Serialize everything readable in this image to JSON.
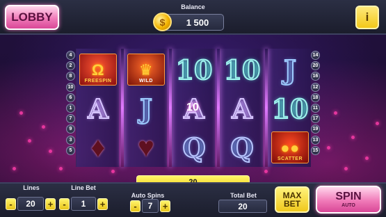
{
  "header": {
    "lobby_label": "LOBBY",
    "balance_label": "Balance",
    "balance_value": "1 500",
    "coin_symbol": "$",
    "info_label": "i"
  },
  "lines": {
    "left": [
      "4",
      "2",
      "8",
      "10",
      "6",
      "1",
      "7",
      "9",
      "3",
      "5"
    ],
    "right": [
      "14",
      "20",
      "16",
      "12",
      "18",
      "11",
      "17",
      "19",
      "13",
      "15"
    ]
  },
  "reels": [
    [
      {
        "type": "tile",
        "variant": "freespin",
        "icon": "horseshoe",
        "label": "FREESPIN"
      },
      {
        "type": "letter",
        "text": "A"
      },
      {
        "type": "suit",
        "icon": "diamond-suit"
      }
    ],
    [
      {
        "type": "tile",
        "variant": "wild",
        "icon": "crown",
        "label": "WILD"
      },
      {
        "type": "letter",
        "text": "J"
      },
      {
        "type": "suit",
        "icon": "heart-suit"
      }
    ],
    [
      {
        "type": "letter",
        "text": "10"
      },
      {
        "type": "letter",
        "text": "A"
      },
      {
        "type": "letter",
        "text": "Q"
      }
    ],
    [
      {
        "type": "letter",
        "text": "10"
      },
      {
        "type": "letter",
        "text": "A"
      },
      {
        "type": "letter",
        "text": "Q"
      }
    ],
    [
      {
        "type": "letter",
        "text": "J"
      },
      {
        "type": "letter",
        "text": "10"
      },
      {
        "type": "tile",
        "variant": "scatter",
        "icon": "coins",
        "label": "SCATTER"
      }
    ]
  ],
  "win_overlay": "10",
  "win_bar_value": "20",
  "controls": {
    "lines_label": "Lines",
    "lines_value": "20",
    "line_bet_label": "Line Bet",
    "line_bet_value": "1",
    "auto_spins_label": "Auto Spins",
    "auto_spins_value": "7",
    "total_bet_label": "Total Bet",
    "total_bet_value": "20",
    "minus": "-",
    "plus": "+",
    "max_bet_line1": "MAX",
    "max_bet_line2": "BET",
    "spin_label": "SPIN",
    "spin_sub": "AUTO"
  },
  "colors": {
    "accent_pink": "#f07ab8",
    "accent_yellow": "#f2c81a",
    "panel_dark": "#1b1d2c"
  }
}
